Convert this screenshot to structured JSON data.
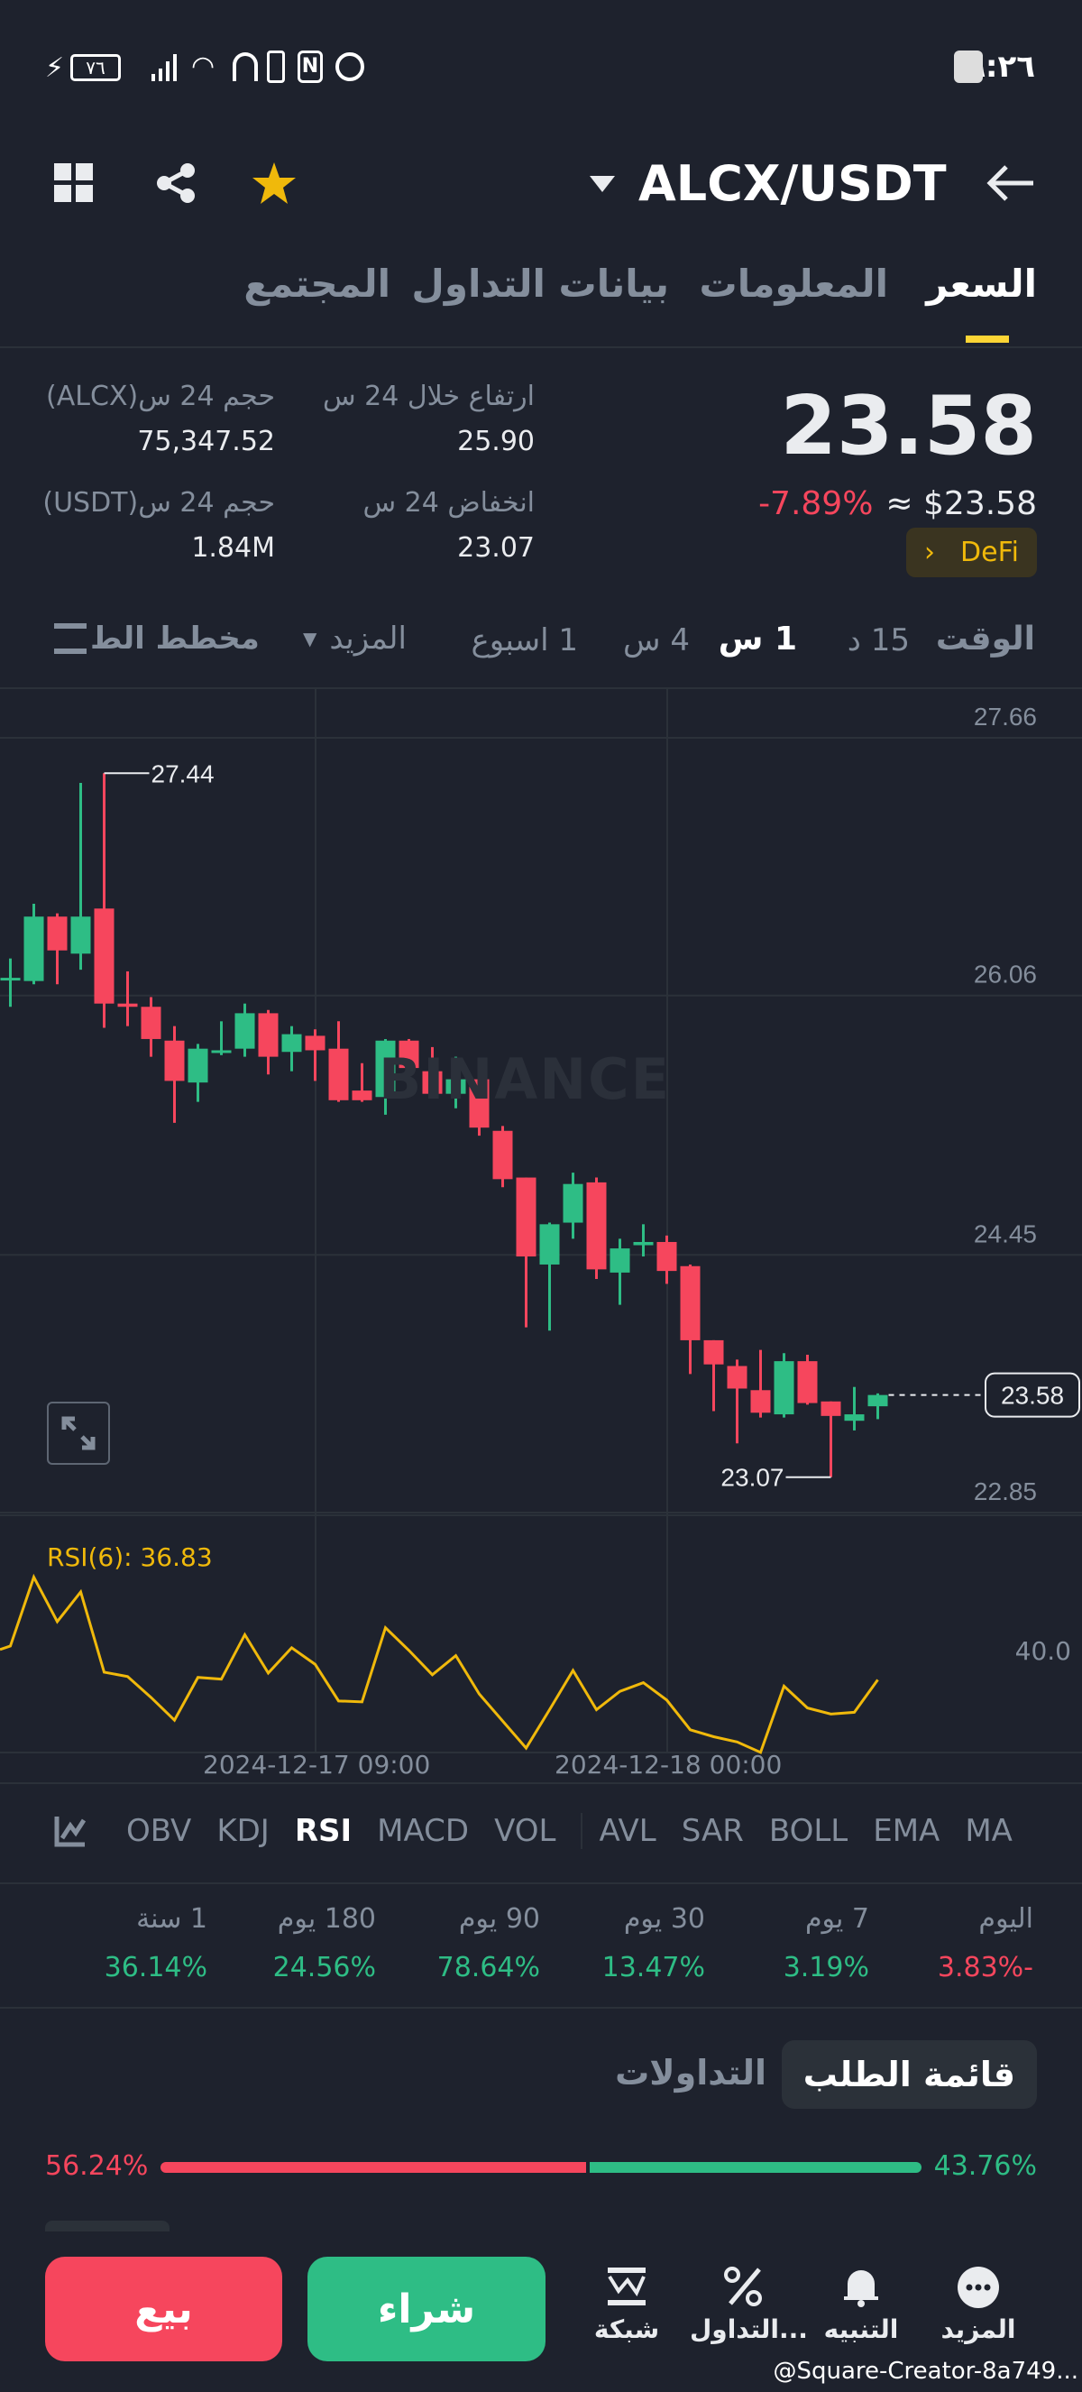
{
  "status_bar": {
    "time": "٩:٢٦",
    "battery": "٧٦"
  },
  "header": {
    "pair": "ALCX/USDT"
  },
  "tabs": [
    {
      "label": "السعر",
      "active": true
    },
    {
      "label": "المعلومات",
      "active": false
    },
    {
      "label": "بيانات التداول",
      "active": false
    },
    {
      "label": "المجتمع",
      "active": false
    }
  ],
  "price": {
    "last": "23.58",
    "usd": "≈ $23.58",
    "change": "-7.89%",
    "tag": "DeFi"
  },
  "stats": {
    "high_label": "ارتفاع خلال 24 س",
    "high": "25.90",
    "low_label": "انخفاض 24 س",
    "low": "23.07",
    "vol_base_label": "حجم 24 س(ALCX)",
    "vol_base": "75,347.52",
    "vol_quote_label": "حجم 24 س(USDT)",
    "vol_quote": "1.84M"
  },
  "timeframes": {
    "label": "الوقت",
    "items": [
      "15 د",
      "1 س",
      "4 س",
      "1 اسبوع"
    ],
    "active": "1 س",
    "more": "المزيد",
    "depth": "مخطط الط"
  },
  "chart_data": {
    "type": "candlestick",
    "interval": "1h",
    "y_ticks": [
      "27.66",
      "26.06",
      "24.45",
      "22.85"
    ],
    "ylim": [
      22.85,
      27.66
    ],
    "high_marker": "27.44",
    "low_marker": "23.07",
    "last_price": "23.58",
    "watermark": "BINANCE",
    "x_labels": [
      "2024-12-17 09:00",
      "2024-12-18 00:00"
    ],
    "candles_ohlc": [
      [
        26.16,
        26.29,
        25.99,
        26.17
      ],
      [
        26.15,
        26.63,
        26.13,
        26.55
      ],
      [
        26.55,
        26.57,
        26.13,
        26.34
      ],
      [
        26.32,
        27.38,
        26.22,
        26.55
      ],
      [
        26.6,
        27.44,
        25.86,
        26.01
      ],
      [
        26.01,
        26.21,
        25.87,
        25.99
      ],
      [
        25.99,
        26.05,
        25.68,
        25.79
      ],
      [
        25.78,
        25.87,
        25.27,
        25.53
      ],
      [
        25.52,
        25.76,
        25.4,
        25.73
      ],
      [
        25.71,
        25.9,
        25.69,
        25.72
      ],
      [
        25.73,
        26.01,
        25.68,
        25.95
      ],
      [
        25.95,
        25.97,
        25.57,
        25.68
      ],
      [
        25.71,
        25.87,
        25.59,
        25.82
      ],
      [
        25.81,
        25.85,
        25.53,
        25.72
      ],
      [
        25.73,
        25.9,
        25.4,
        25.41
      ],
      [
        25.47,
        25.64,
        25.4,
        25.41
      ],
      [
        25.43,
        25.79,
        25.32,
        25.78
      ],
      [
        25.78,
        25.79,
        25.57,
        25.61
      ],
      [
        25.59,
        25.74,
        25.44,
        25.45
      ],
      [
        25.45,
        25.68,
        25.36,
        25.54
      ],
      [
        25.54,
        25.55,
        25.19,
        25.24
      ],
      [
        25.22,
        25.25,
        24.87,
        24.92
      ],
      [
        24.93,
        24.93,
        24.0,
        24.44
      ],
      [
        24.39,
        24.65,
        23.98,
        24.64
      ],
      [
        24.65,
        24.96,
        24.55,
        24.89
      ],
      [
        24.9,
        24.93,
        24.3,
        24.36
      ],
      [
        24.34,
        24.55,
        24.14,
        24.49
      ],
      [
        24.51,
        24.64,
        24.44,
        24.53
      ],
      [
        24.53,
        24.57,
        24.27,
        24.35
      ],
      [
        24.38,
        24.39,
        23.71,
        23.92
      ],
      [
        23.92,
        23.92,
        23.48,
        23.77
      ],
      [
        23.76,
        23.8,
        23.28,
        23.62
      ],
      [
        23.61,
        23.86,
        23.44,
        23.47
      ],
      [
        23.46,
        23.84,
        23.44,
        23.79
      ],
      [
        23.79,
        23.83,
        23.52,
        23.53
      ],
      [
        23.54,
        23.54,
        23.07,
        23.45
      ],
      [
        23.42,
        23.63,
        23.36,
        23.46
      ],
      [
        23.51,
        23.59,
        23.43,
        23.58
      ]
    ],
    "rsi": {
      "label": "RSI(6): 36.83",
      "tick": "40.0",
      "values": [
        40.7,
        48.6,
        43.5,
        46.9,
        37.7,
        37.2,
        34.8,
        32.2,
        37.1,
        36.9,
        42.0,
        37.6,
        40.5,
        38.6,
        34.4,
        34.3,
        42.8,
        40.2,
        37.4,
        39.6,
        35.2,
        32.1,
        29.0,
        33.4,
        37.9,
        33.4,
        35.5,
        36.5,
        34.5,
        31.1,
        30.3,
        29.7,
        28.5,
        36.1,
        33.6,
        32.9,
        33.1,
        36.83
      ]
    },
    "colors": {
      "up": "#2ebd85",
      "down": "#f6465d",
      "rsi": "#f0b90b"
    }
  },
  "indicators": {
    "items": [
      "OBV",
      "KDJ",
      "RSI",
      "MACD",
      "VOL",
      "AVL",
      "SAR",
      "BOLL",
      "EMA",
      "MA"
    ],
    "active": "RSI"
  },
  "performance": [
    {
      "label": "اليوم",
      "value": "3.83%-",
      "trend": "down"
    },
    {
      "label": "7 يوم",
      "value": "3.19%",
      "trend": "up"
    },
    {
      "label": "30 يوم",
      "value": "13.47%",
      "trend": "up"
    },
    {
      "label": "90 يوم",
      "value": "78.64%",
      "trend": "up"
    },
    {
      "label": "180 يوم",
      "value": "24.56%",
      "trend": "up"
    },
    {
      "label": "1 سنة",
      "value": "36.14%",
      "trend": "up"
    }
  ],
  "orderbook": {
    "tab_book": "قائمة الطلب",
    "tab_trades": "التداولات",
    "sell_pct": "56.24%",
    "buy_pct": "43.76%",
    "sell_ratio": 0.5624
  },
  "bottom_bar": {
    "more": "المزيد",
    "alert": "التنبيه",
    "trade": "التداول...",
    "grid": "شبكة",
    "buy": "شراء",
    "sell": "بيع"
  },
  "watermark": "@Square-Creator-8a749..."
}
